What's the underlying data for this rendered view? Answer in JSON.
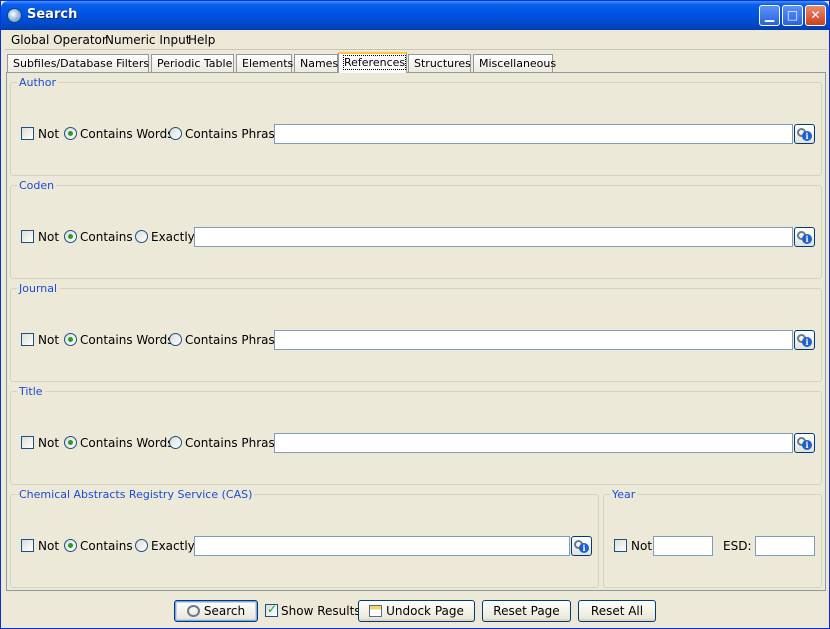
{
  "window": {
    "title": "Search",
    "icon": "app-globe-icon",
    "controls": [
      "minimize",
      "maximize",
      "close"
    ]
  },
  "menu": {
    "items": [
      "Global Operator",
      "Numeric Input",
      "Help"
    ]
  },
  "tabs": {
    "items": [
      "Subfiles/Database Filters",
      "Periodic Table",
      "Elements",
      "Names",
      "References",
      "Structures",
      "Miscellaneous"
    ],
    "active": "References"
  },
  "groups": {
    "author": {
      "label": "Author",
      "not": "Not",
      "opt1": "Contains Words",
      "opt2": "Contains Phrase",
      "value": ""
    },
    "coden": {
      "label": "Coden",
      "not": "Not",
      "opt1": "Contains",
      "opt2": "Exactly",
      "value": ""
    },
    "journal": {
      "label": "Journal",
      "not": "Not",
      "opt1": "Contains Words",
      "opt2": "Contains Phrase",
      "value": ""
    },
    "title": {
      "label": "Title",
      "not": "Not",
      "opt1": "Contains Words",
      "opt2": "Contains Phrase",
      "value": ""
    },
    "cas": {
      "label": "Chemical Abstracts Registry Service (CAS)",
      "not": "Not",
      "opt1": "Contains",
      "opt2": "Exactly",
      "value": ""
    },
    "year": {
      "label": "Year",
      "not": "Not",
      "esd": "ESD:",
      "value": "",
      "esd_value": ""
    }
  },
  "bottom": {
    "search": "Search",
    "show_results": "Show Results",
    "show_results_checked": true,
    "undock": "Undock Page",
    "reset_page": "Reset Page",
    "reset_all": "Reset All"
  },
  "colors": {
    "group_label": "#1c4bd6",
    "titlebar": "#0054e3",
    "background": "#ece9d8"
  }
}
